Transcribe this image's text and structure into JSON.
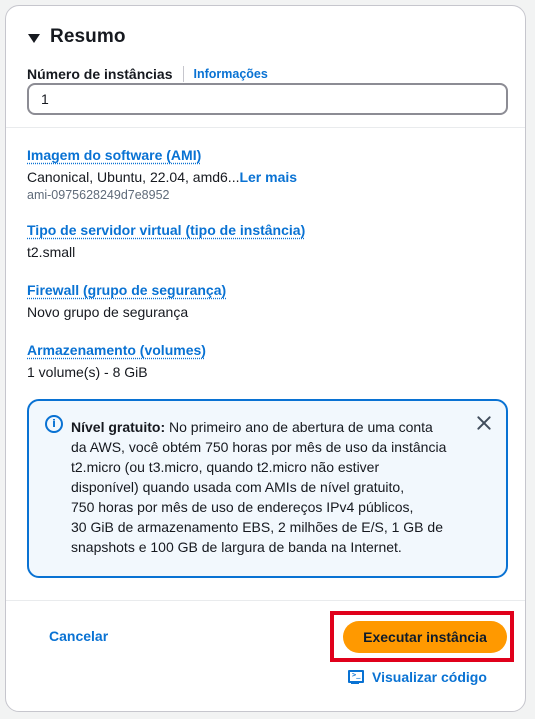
{
  "summary": {
    "title": "Resumo",
    "instances_label": "Número de instâncias",
    "info_link": "Informações",
    "instances_value": "1"
  },
  "ami": {
    "title": "Imagem do software (AMI)",
    "description": "Canonical, Ubuntu, 22.04, amd6...",
    "more_link": "Ler mais",
    "id": "ami-0975628249d7e8952"
  },
  "instance_type": {
    "title": "Tipo de servidor virtual (tipo de instância)",
    "value": "t2.small"
  },
  "firewall": {
    "title": "Firewall (grupo de segurança)",
    "value": "Novo grupo de segurança"
  },
  "storage": {
    "title": "Armazenamento (volumes)",
    "value": "1 volume(s) - 8 GiB"
  },
  "alert": {
    "label": "Nível gratuito:",
    "lines": [
      " No primeiro ano de abertura de uma conta",
      "da AWS, você obtém 750 horas por mês de uso da instância",
      "t2.micro (ou t3.micro, quando t2.micro não estiver",
      "disponível) quando usada com AMIs de nível gratuito,",
      "750 horas por mês de uso de endereços IPv4 públicos,",
      "30 GiB de armazenamento EBS, 2 milhões de E/S, 1 GB de",
      "snapshots e 100 GB de largura de banda na Internet."
    ]
  },
  "footer": {
    "cancel": "Cancelar",
    "launch": "Executar instância",
    "view_code": "Visualizar código"
  },
  "colors": {
    "link": "#0972d3",
    "primary": "#ff9900",
    "highlight": "#e0001b",
    "alert_bg": "#f2f8fd"
  },
  "icons": [
    "caret-down-icon",
    "info-icon",
    "close-icon",
    "code-icon"
  ]
}
